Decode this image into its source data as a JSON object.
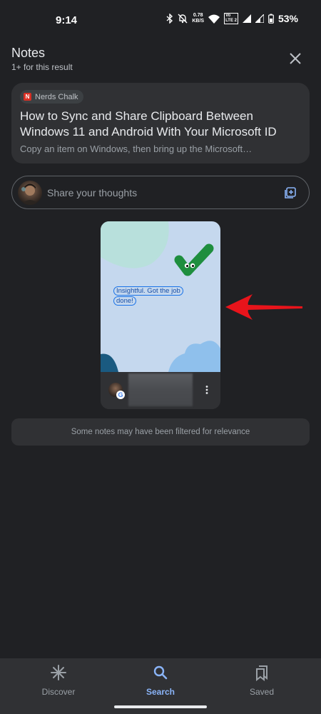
{
  "status_bar": {
    "time": "9:14",
    "net_speed_value": "0.78",
    "net_speed_unit": "KB/S",
    "lte_top": "Vo",
    "lte_bottom": "LTE 2",
    "battery": "53%"
  },
  "header": {
    "title": "Notes",
    "subtitle": "1+ for this result"
  },
  "article": {
    "source_logo_letter": "N",
    "source_name": "Nerds Chalk",
    "title": "How to Sync and Share Clipboard Between Windows 11 and Android With Your Microsoft ID",
    "snippet": "Copy an item on Windows, then bring up the Microsoft…"
  },
  "share": {
    "placeholder": "Share your thoughts"
  },
  "note_preview": {
    "text": "Insightful. Got the job done!",
    "badge_letter": "G"
  },
  "filter_notice": "Some notes may have been filtered for relevance",
  "bottom_nav": {
    "items": [
      {
        "label": "Discover",
        "icon": "asterisk-icon",
        "active": false
      },
      {
        "label": "Search",
        "icon": "search-icon",
        "active": true
      },
      {
        "label": "Saved",
        "icon": "bookmarks-icon",
        "active": false
      }
    ]
  },
  "colors": {
    "background": "#202124",
    "card": "#303134",
    "accent_blue": "#8ab4f8",
    "annotation_red": "#e8141b",
    "check_green": "#1e8e3e"
  }
}
